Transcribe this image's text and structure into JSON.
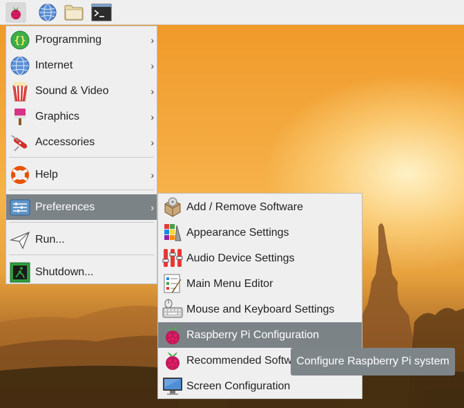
{
  "taskbar": {
    "buttons": [
      {
        "icon": "raspberry-icon"
      },
      {
        "icon": "web-browser-icon"
      },
      {
        "icon": "folder-icon"
      },
      {
        "icon": "terminal-icon"
      }
    ]
  },
  "menu": {
    "items": [
      {
        "label": "Programming",
        "icon": "programming-icon",
        "submenu": true
      },
      {
        "label": "Internet",
        "icon": "internet-icon",
        "submenu": true
      },
      {
        "label": "Sound & Video",
        "icon": "sound-video-icon",
        "submenu": true
      },
      {
        "label": "Graphics",
        "icon": "graphics-icon",
        "submenu": true
      },
      {
        "label": "Accessories",
        "icon": "accessories-icon",
        "submenu": true
      },
      {
        "label": "Help",
        "icon": "help-icon",
        "submenu": true
      },
      {
        "label": "Preferences",
        "icon": "preferences-icon",
        "submenu": true,
        "selected": true
      },
      {
        "label": "Run...",
        "icon": "run-icon",
        "submenu": false
      },
      {
        "label": "Shutdown...",
        "icon": "shutdown-icon",
        "submenu": false
      }
    ],
    "arrow": "›"
  },
  "submenu": {
    "items": [
      {
        "label": "Add / Remove Software",
        "icon": "software-package-icon"
      },
      {
        "label": "Appearance Settings",
        "icon": "appearance-settings-icon"
      },
      {
        "label": "Audio Device Settings",
        "icon": "audio-mixer-icon"
      },
      {
        "label": "Main Menu Editor",
        "icon": "menu-editor-icon"
      },
      {
        "label": "Mouse and Keyboard Settings",
        "icon": "keyboard-mouse-icon"
      },
      {
        "label": "Raspberry Pi Configuration",
        "icon": "raspberry-icon",
        "selected": true
      },
      {
        "label": "Recommended Software",
        "icon": "raspberry-icon"
      },
      {
        "label": "Screen Configuration",
        "icon": "monitor-icon"
      }
    ]
  },
  "tooltip": {
    "text": "Configure Raspberry Pi system"
  },
  "colors": {
    "selection": "#7c8387",
    "menu_bg": "#efefef",
    "tooltip_bg": "#7e8589"
  }
}
